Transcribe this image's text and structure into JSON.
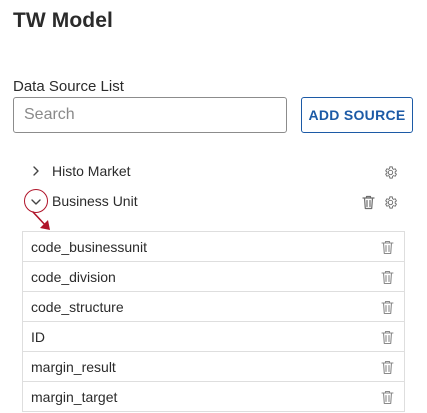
{
  "page": {
    "title": "TW Model"
  },
  "data_source_list": {
    "label": "Data Source List",
    "search": {
      "placeholder": "Search",
      "value": ""
    },
    "add_source_label": "ADD SOURCE",
    "sources": [
      {
        "name": "Histo Market",
        "expanded": false
      },
      {
        "name": "Business Unit",
        "expanded": true
      }
    ],
    "fields": [
      "code_businessunit",
      "code_division",
      "code_structure",
      "ID",
      "margin_result",
      "margin_target"
    ]
  },
  "annotation": {
    "color": "#b0142a"
  },
  "icons": {
    "expand": "chevron-right-icon",
    "collapse": "chevron-down-icon",
    "settings": "gear-icon",
    "delete": "trash-icon"
  },
  "colors": {
    "accent": "#1c5aa6",
    "border": "#dedede",
    "icon": "#6d6d6d"
  }
}
